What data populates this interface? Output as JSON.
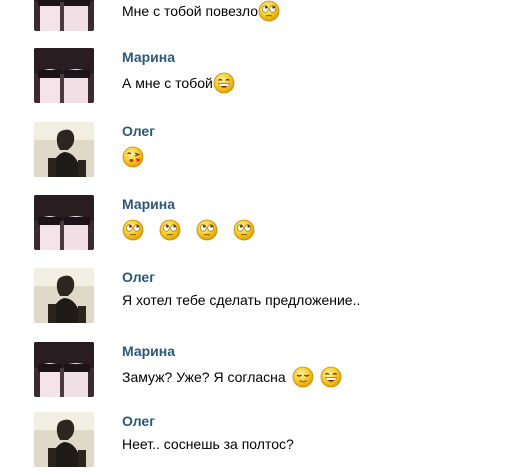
{
  "messages": [
    {
      "author": "",
      "text": "Мне с тобой повезло",
      "avatar": "girl-avatar",
      "emojis": [
        "rolling-eyes-emoji"
      ]
    },
    {
      "author": "Марина",
      "text": "А мне с тобой",
      "avatar": "girl-avatar",
      "emojis": [
        "grin-emoji"
      ]
    },
    {
      "author": "Олег",
      "text": "",
      "avatar": "man-avatar",
      "emojis": [
        "kiss-emoji"
      ]
    },
    {
      "author": "Марина",
      "text": "",
      "avatar": "girl-avatar",
      "emojis": [
        "rolling-eyes-emoji",
        "rolling-eyes-emoji",
        "rolling-eyes-emoji",
        "rolling-eyes-emoji"
      ]
    },
    {
      "author": "Олег",
      "text": "Я хотел тебе сделать предложение..",
      "avatar": "man-avatar",
      "emojis": []
    },
    {
      "author": "Марина",
      "text": "Замуж? Уже? Я согласна",
      "avatar": "girl-avatar",
      "emojis": [
        "relieved-emoji",
        "grin-emoji"
      ]
    },
    {
      "author": "Олег",
      "text": "Неет.. соснешь за полтос?",
      "avatar": "man-avatar",
      "emojis": []
    }
  ],
  "colors": {
    "author_name": "#2b587a",
    "message_text": "#000000",
    "emoji_face": "#f5c518"
  }
}
